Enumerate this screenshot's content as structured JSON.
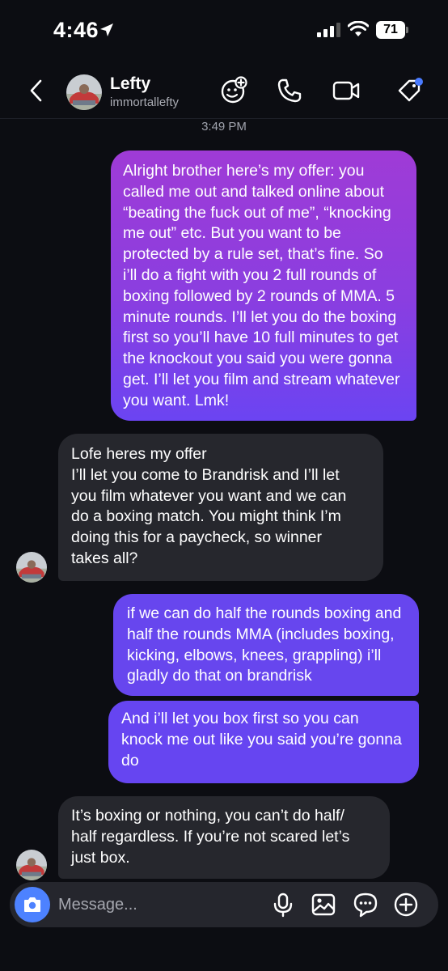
{
  "status": {
    "time": "4:46",
    "battery": "71"
  },
  "header": {
    "contact_name": "Lefty",
    "contact_handle": "immortallefty"
  },
  "timestamp": "3:49 PM",
  "messages": [
    {
      "direction": "outgoing",
      "lines": [
        "Alright brother here’s my offer: you",
        "called me out and talked online about",
        "“beating the fuck out of me”, “knocking",
        "me out” etc. But you want to be",
        "protected by a rule set, that’s fine. So",
        "i’ll do a fight with you 2 full rounds of",
        "boxing followed by 2 rounds of MMA. 5",
        "minute rounds. I’ll let you do the boxing",
        "first so you’ll have 10 full minutes to get",
        "the knockout you said you were gonna",
        "get. I’ll let you film and stream whatever",
        "you want. Lmk!"
      ]
    },
    {
      "direction": "incoming",
      "lines": [
        "Lofe heres my offer",
        "I’ll let you come to Brandrisk and I’ll let",
        "you film whatever you want and we can",
        "do a boxing match. You might think I’m",
        "doing this for a paycheck, so winner",
        "takes all?"
      ]
    },
    {
      "direction": "outgoing",
      "lines": [
        "if we can do half the rounds boxing and",
        "half the rounds MMA (includes boxing,",
        "kicking, elbows, knees, grappling) i’ll",
        "gladly do that on brandrisk"
      ]
    },
    {
      "direction": "outgoing",
      "lines": [
        "And i’ll let you box first so you can",
        "knock me out like you said you’re gonna",
        "do"
      ]
    },
    {
      "direction": "incoming",
      "lines": [
        "It’s boxing or nothing, you can’t do half/",
        "half regardless. If you’re not scared let’s",
        "just box."
      ]
    }
  ],
  "composer": {
    "placeholder": "Message..."
  },
  "colors": {
    "background": "#0c0d12",
    "incoming_bubble": "#26272d",
    "outgoing_top": "#9f3bd6",
    "outgoing_bottom": "#6645f1",
    "accent_blue": "#4d82ff"
  },
  "icons": [
    "location-arrow-icon",
    "signal-icon",
    "wifi-icon",
    "battery-icon",
    "back-chevron-icon",
    "effects-icon",
    "phone-icon",
    "video-camera-icon",
    "tag-icon",
    "camera-icon",
    "microphone-icon",
    "gallery-icon",
    "sticker-icon",
    "plus-icon"
  ]
}
